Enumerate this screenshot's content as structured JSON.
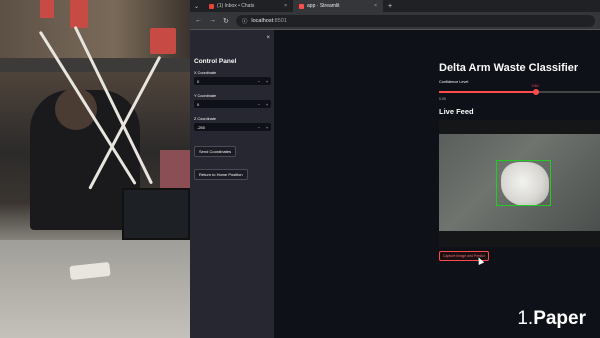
{
  "tabs": [
    {
      "label": "(1) Inbox • Chats",
      "icon": "mail-icon",
      "color": "#ea4335"
    },
    {
      "label": "app · Streamlit",
      "icon": "streamlit-icon",
      "color": "#ff4b4b"
    }
  ],
  "address": {
    "host": "localhost",
    "port": ":8501"
  },
  "sidebar": {
    "title": "Control Panel",
    "fields": [
      {
        "label": "X Coordinate",
        "value": "0"
      },
      {
        "label": "Y Coordinate",
        "value": "0"
      },
      {
        "label": "Z Coordinate",
        "value": "-250"
      }
    ],
    "send_btn": "Send Coordinates",
    "home_btn": "Return to Home Position"
  },
  "main": {
    "title": "Delta Arm Waste Classifier",
    "conf_label": "Confidence Level",
    "conf_value": "0.60",
    "conf_min": "0.00",
    "conf_fraction": 0.6,
    "live_title": "Live Feed",
    "capture_btn": "Capture Image and Predict"
  },
  "caption": {
    "num": "1.",
    "word": "Paper"
  },
  "colors": {
    "accent": "#ff4b4b",
    "bbox": "#22cc22"
  }
}
